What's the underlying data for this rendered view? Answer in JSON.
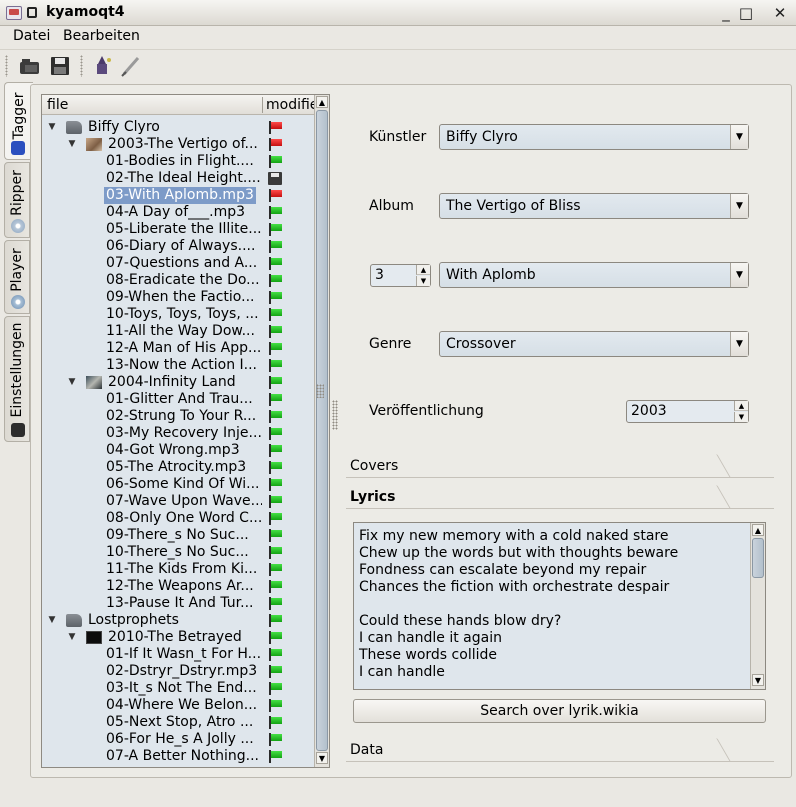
{
  "window": {
    "title": "kyamoqt4",
    "minimize": "_",
    "maximize": "□",
    "close": "✕"
  },
  "menu": [
    {
      "label": "Datei"
    },
    {
      "label": "Bearbeiten"
    }
  ],
  "tabs": [
    {
      "label": "Tagger",
      "active": true
    },
    {
      "label": "Ripper"
    },
    {
      "label": "Player"
    },
    {
      "label": "Einstellungen"
    }
  ],
  "tree": {
    "columns": [
      "file",
      "modifie"
    ],
    "rows": [
      {
        "level": 0,
        "expander": "▼",
        "icon": "artist",
        "text": "Biffy Clyro",
        "flag": "red"
      },
      {
        "level": 1,
        "expander": "▼",
        "icon": "cover1",
        "text": "2003-The Vertigo of...",
        "flag": "red"
      },
      {
        "level": 2,
        "text": "01-Bodies in Flight....",
        "flag": "green"
      },
      {
        "level": 2,
        "text": "02-The Ideal Height....",
        "flag": "save"
      },
      {
        "level": 2,
        "text": "03-With Aplomb.mp3",
        "flag": "red",
        "selected": true
      },
      {
        "level": 2,
        "text": "04-A Day of___.mp3",
        "flag": "green"
      },
      {
        "level": 2,
        "text": "05-Liberate the Illite...",
        "flag": "green"
      },
      {
        "level": 2,
        "text": "06-Diary of Always....",
        "flag": "green"
      },
      {
        "level": 2,
        "text": "07-Questions and A...",
        "flag": "green"
      },
      {
        "level": 2,
        "text": "08-Eradicate the Do...",
        "flag": "green"
      },
      {
        "level": 2,
        "text": "09-When the Factio...",
        "flag": "green"
      },
      {
        "level": 2,
        "text": "10-Toys, Toys, Toys, ...",
        "flag": "green"
      },
      {
        "level": 2,
        "text": "11-All the Way Dow...",
        "flag": "green"
      },
      {
        "level": 2,
        "text": "12-A Man of His App...",
        "flag": "green"
      },
      {
        "level": 2,
        "text": "13-Now the Action I...",
        "flag": "green"
      },
      {
        "level": 1,
        "expander": "▼",
        "icon": "cover2",
        "text": "2004-Infinity Land",
        "flag": "green"
      },
      {
        "level": 2,
        "text": "01-Glitter And Trau...",
        "flag": "green"
      },
      {
        "level": 2,
        "text": "02-Strung To Your R...",
        "flag": "green"
      },
      {
        "level": 2,
        "text": "03-My Recovery Inje...",
        "flag": "green"
      },
      {
        "level": 2,
        "text": "04-Got Wrong.mp3",
        "flag": "green"
      },
      {
        "level": 2,
        "text": "05-The Atrocity.mp3",
        "flag": "green"
      },
      {
        "level": 2,
        "text": "06-Some Kind Of Wi...",
        "flag": "green"
      },
      {
        "level": 2,
        "text": "07-Wave Upon Wave...",
        "flag": "green"
      },
      {
        "level": 2,
        "text": "08-Only One Word C...",
        "flag": "green"
      },
      {
        "level": 2,
        "text": "09-There_s No Suc...",
        "flag": "green"
      },
      {
        "level": 2,
        "text": "10-There_s No Suc...",
        "flag": "green"
      },
      {
        "level": 2,
        "text": "11-The Kids From Ki...",
        "flag": "green"
      },
      {
        "level": 2,
        "text": "12-The Weapons Ar...",
        "flag": "green"
      },
      {
        "level": 2,
        "text": "13-Pause It And Tur...",
        "flag": "green"
      },
      {
        "level": 0,
        "expander": "▼",
        "icon": "artist",
        "text": "Lostprophets",
        "flag": "green"
      },
      {
        "level": 1,
        "expander": "▼",
        "icon": "cover3",
        "text": "2010-The Betrayed",
        "flag": "green"
      },
      {
        "level": 2,
        "text": "01-If It Wasn_t For H...",
        "flag": "green"
      },
      {
        "level": 2,
        "text": "02-Dstryr_Dstryr.mp3",
        "flag": "green"
      },
      {
        "level": 2,
        "text": "03-It_s Not The End...",
        "flag": "green"
      },
      {
        "level": 2,
        "text": "04-Where We Belon...",
        "flag": "green"
      },
      {
        "level": 2,
        "text": "05-Next Stop, Atro ...",
        "flag": "green"
      },
      {
        "level": 2,
        "text": "06-For He_s A Jolly ...",
        "flag": "green"
      },
      {
        "level": 2,
        "text": "07-A Better Nothing...",
        "flag": "green"
      }
    ]
  },
  "form": {
    "artist_label": "Künstler",
    "artist_value": "Biffy Clyro",
    "album_label": "Album",
    "album_value": "The Vertigo of Bliss",
    "track_number": "3",
    "title_value": "With Aplomb",
    "genre_label": "Genre",
    "genre_value": "Crossover",
    "release_label": "Veröffentlichung",
    "release_value": "2003"
  },
  "sections": {
    "covers": "Covers",
    "lyrics": "Lyrics",
    "data": "Data"
  },
  "lyrics": {
    "lines": [
      "Fix my new memory with a cold naked stare",
      "Chew up the words but with thoughts beware",
      "Fondness can escalate beyond my repair",
      "Chances the fiction with orchestrate despair",
      "",
      "Could these hands blow dry?",
      "I can handle it again",
      "These words collide",
      "I can handle"
    ],
    "search_button": "Search over lyrik.wikia"
  },
  "colors": {
    "selection": "#7d9bc8",
    "field_bg": "#dfe6ec"
  }
}
